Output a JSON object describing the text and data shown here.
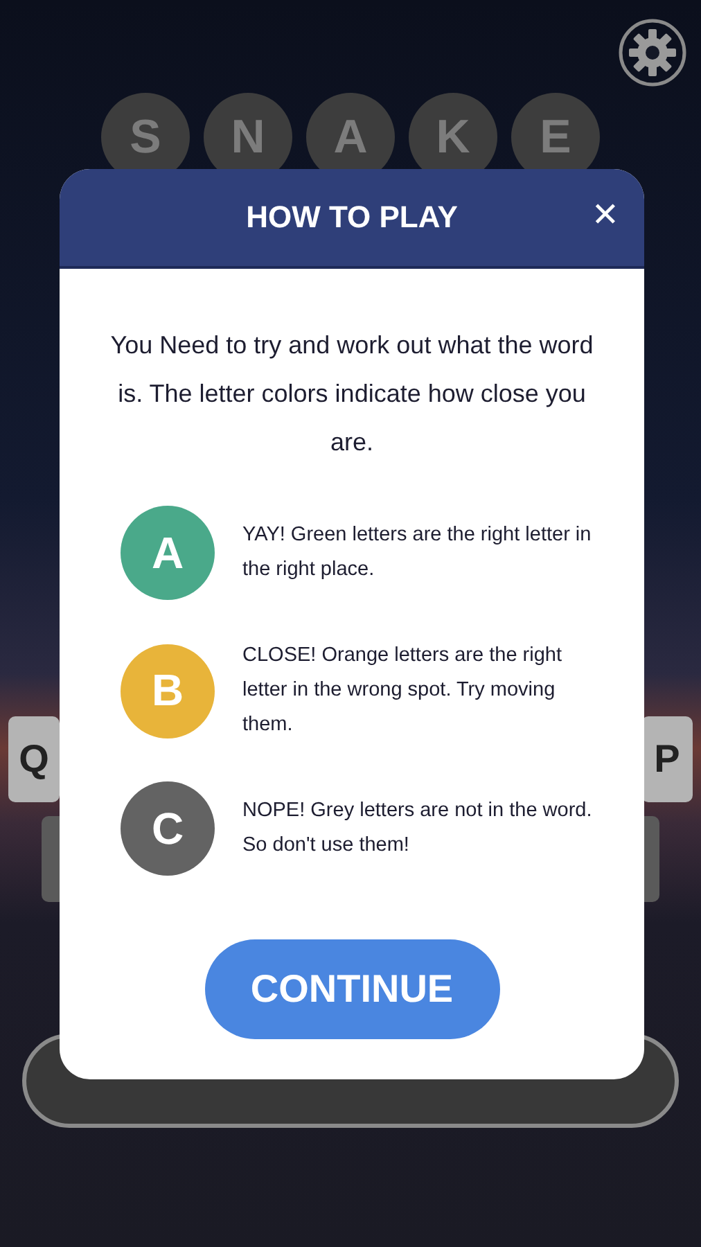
{
  "word_tiles": [
    "S",
    "N",
    "A",
    "K",
    "E"
  ],
  "keyboard": {
    "row_1": [
      "Q",
      "P"
    ]
  },
  "dialog": {
    "title": "HOW TO PLAY",
    "close": "✕",
    "intro": "You Need to try and work out what the word is. The letter colors indicate how close you are.",
    "rules": [
      {
        "letter": "A",
        "color": "#4aa98a",
        "text": "YAY!  Green letters are the right letter in the right place."
      },
      {
        "letter": "B",
        "color": "#e8b43a",
        "text": "CLOSE! Orange letters are the right letter in the wrong spot. Try moving them."
      },
      {
        "letter": "C",
        "color": "#636363",
        "text": "NOPE! Grey letters are not in the word. So don't use them!"
      }
    ],
    "continue": "CONTINUE"
  }
}
